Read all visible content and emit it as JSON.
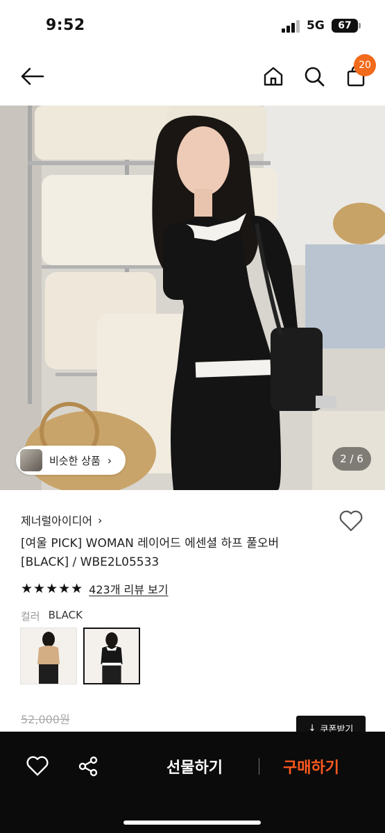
{
  "status_bar": {
    "time": "9:52",
    "network": "5G",
    "battery": "67"
  },
  "header": {
    "back_icon": "arrow-left-icon",
    "home_icon": "home-icon",
    "search_icon": "search-icon",
    "cart_icon": "shopping-bag-icon",
    "cart_badge": "20",
    "badge_color": "#f26a1b"
  },
  "gallery": {
    "similar_products_label": "비슷한 상품",
    "similar_chevron": "›",
    "counter": "2 / 6"
  },
  "product": {
    "brand": "제너럴아이디어",
    "brand_chevron": "›",
    "title": "[여울 PICK] WOMAN 레이어드 에센셜 하프 풀오버 [BLACK] / WBE2L05533",
    "rating_stars": "★★★★★",
    "review_link": "423개 리뷰 보기",
    "color_label": "컬러",
    "color_value": "BLACK",
    "original_price": "52,000원",
    "coupon_label": "쿠폰받기",
    "coupon_icon": "↓"
  },
  "bottom_bar": {
    "gift_label": "선물하기",
    "buy_label": "구매하기",
    "buy_color": "#ff5a1f",
    "wish_icon": "heart-outline-icon",
    "share_icon": "share-icon"
  }
}
